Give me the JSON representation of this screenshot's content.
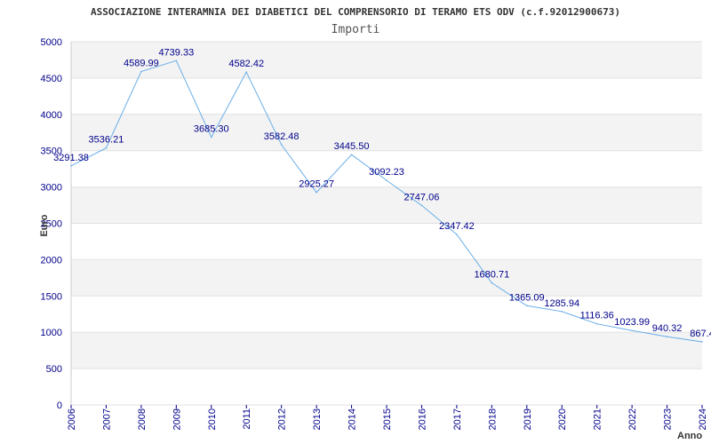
{
  "chart_data": {
    "type": "line",
    "title": "ASSOCIAZIONE INTERAMNIA DEI DIABETICI DEL COMPRENSORIO DI TERAMO ETS ODV (c.f.92012900673)",
    "subtitle": "Importi",
    "xlabel": "Anno",
    "ylabel": "Euro",
    "ylim": [
      0,
      5000
    ],
    "yticks": [
      "0",
      "500",
      "1000",
      "1500",
      "2000",
      "2500",
      "3000",
      "3500",
      "4000",
      "4500",
      "5000"
    ],
    "categories": [
      "2006",
      "2007",
      "2008",
      "2009",
      "2010",
      "2011",
      "2012",
      "2013",
      "2014",
      "2015",
      "2016",
      "2017",
      "2018",
      "2019",
      "2020",
      "2021",
      "2022",
      "2023",
      "2024"
    ],
    "series": [
      {
        "values": [
          3291.38,
          3536.21,
          4589.99,
          4739.33,
          3685.3,
          4582.42,
          3582.48,
          2925.27,
          3445.5,
          3092.23,
          2747.06,
          2347.42,
          1680.71,
          1365.09,
          1285.94,
          1116.36,
          1023.99,
          940.32,
          867.4
        ],
        "labels": [
          "3291.38",
          "3536.21",
          "4589.99",
          "4739.33",
          "3685.30",
          "4582.42",
          "3582.48",
          "2925.27",
          "3445.50",
          "3092.23",
          "2747.06",
          "2347.42",
          "1680.71",
          "1365.09",
          "1285.94",
          "1116.36",
          "1023.99",
          "940.32",
          "867.4"
        ],
        "color": "#6aaee8"
      }
    ],
    "grid": true,
    "band_colors": [
      "#ffffff",
      "#f3f3f3"
    ],
    "grid_color": "#e2e2e2",
    "tick_color": "#00008b",
    "legend": "none"
  }
}
